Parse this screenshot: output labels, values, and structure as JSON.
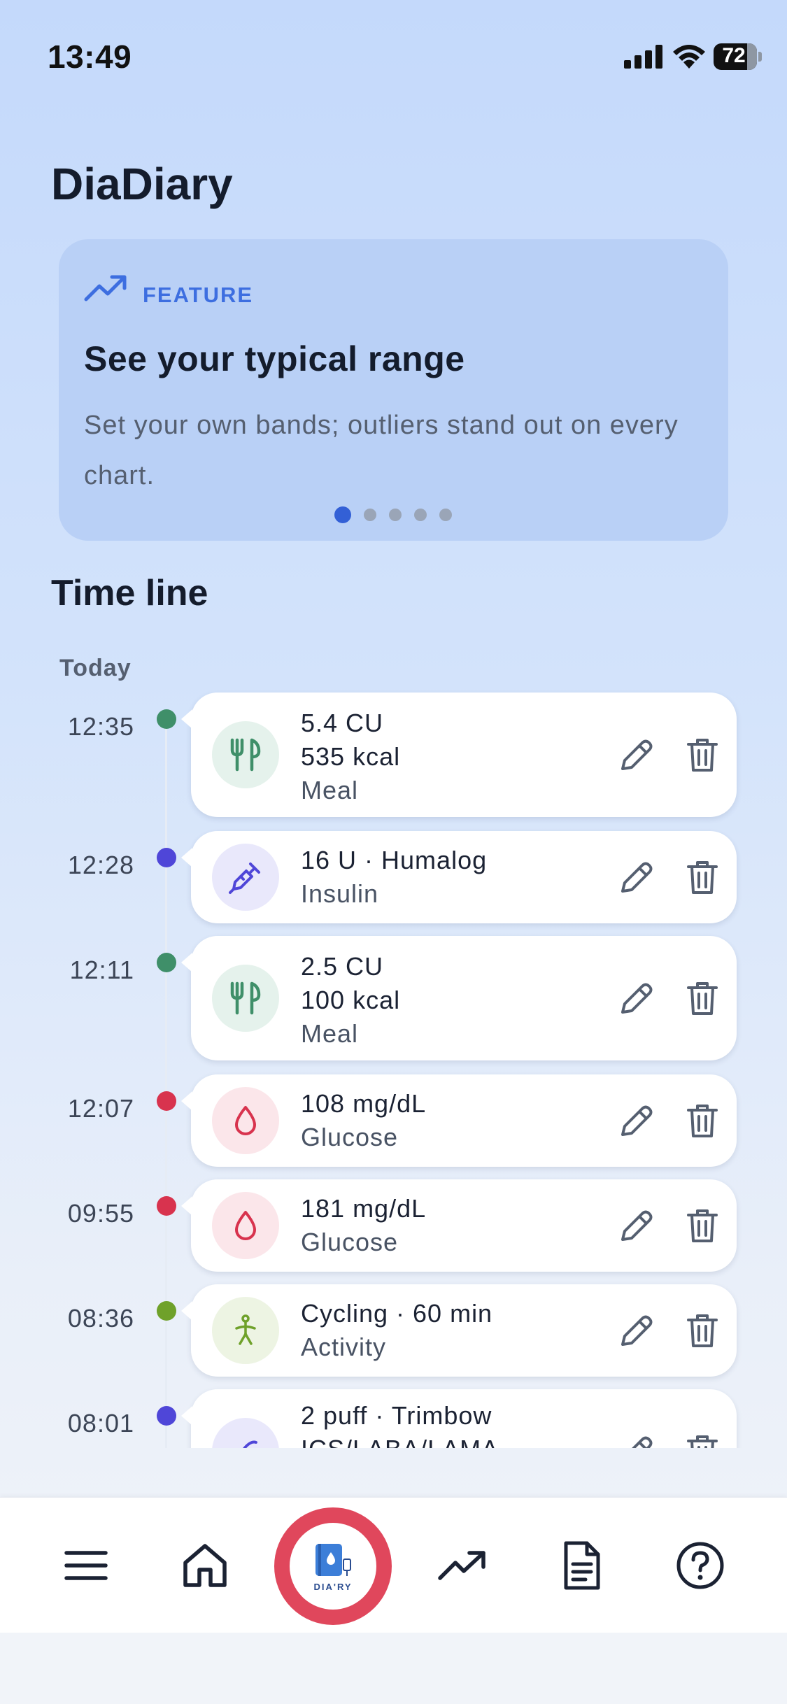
{
  "status_bar": {
    "time": "13:49",
    "battery": "72"
  },
  "app": {
    "title": "DiaDiary"
  },
  "feature": {
    "tag": "FEATURE",
    "title": "See your typical range",
    "text": "Set your own bands; outliers stand out on every chart.",
    "page_count": 5,
    "active_page": 0
  },
  "timeline": {
    "title": "Time line",
    "day_label": "Today",
    "entries": [
      {
        "time": "12:35",
        "lines": [
          "5.4 CU",
          "535 kcal"
        ],
        "category": "Meal",
        "type": "meal"
      },
      {
        "time": "12:28",
        "lines": [
          "16 U · Humalog"
        ],
        "category": "Insulin",
        "type": "insulin"
      },
      {
        "time": "12:11",
        "lines": [
          "2.5 CU",
          "100 kcal"
        ],
        "category": "Meal",
        "type": "meal"
      },
      {
        "time": "12:07",
        "lines": [
          "108 mg/dL"
        ],
        "category": "Glucose",
        "type": "glucose"
      },
      {
        "time": "09:55",
        "lines": [
          "181 mg/dL"
        ],
        "category": "Glucose",
        "type": "glucose"
      },
      {
        "time": "08:36",
        "lines": [
          "Cycling · 60 min"
        ],
        "category": "Activity",
        "type": "activity"
      },
      {
        "time": "08:01",
        "lines": [
          "2 puff · Trimbow",
          "ICS/LABA/LAMA"
        ],
        "category": "",
        "type": "inhaler"
      }
    ]
  },
  "bottom_nav": {
    "items": [
      "menu-icon",
      "home-icon",
      "diary-logo",
      "trending-up-icon",
      "report-icon",
      "help-icon"
    ],
    "logo_text": "DIA'RY"
  },
  "colors": {
    "meal": "#3f8f69",
    "meal_bg": "#e5f2ec",
    "insulin": "#4f46d8",
    "insulin_bg": "#e9e8fb",
    "glucose": "#d8334e",
    "glucose_bg": "#fbe6ea",
    "activity": "#6fa12a",
    "activity_bg": "#edf4e3",
    "accent": "#3360d6",
    "logo_ring": "#e0475c"
  }
}
